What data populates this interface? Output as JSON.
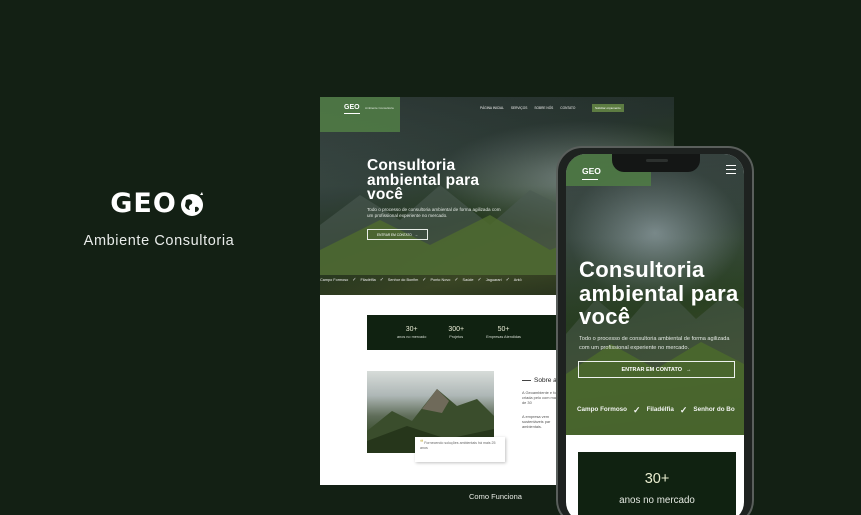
{
  "brand": {
    "logo_text": "GEO",
    "subtitle": "Ambiente Consultoria"
  },
  "desktop": {
    "logo_text": "GEO",
    "logo_tag": "Ambiente Consultoria",
    "nav": [
      "PÁGINA INICIAL",
      "SERVIÇOS",
      "SOBRE NÓS",
      "CONTATO"
    ],
    "nav_cta": "Solicitar orçamento",
    "hero_title": "Consultoria ambiental para você",
    "hero_desc": "Todo o processo de consultoria ambiental de forma agilizada com um profissional experiente no mercado.",
    "hero_button": "ENTRAR EM CONTATO",
    "ticker": [
      "Campo Formoso",
      "Filadélfia",
      "Senhor do Bonfim",
      "Ponto Novo",
      "Saúde",
      "Jaguarari",
      "Antô"
    ],
    "stats": [
      {
        "number": "30+",
        "label": "anos no mercado"
      },
      {
        "number": "300+",
        "label": "Projetos"
      },
      {
        "number": "50+",
        "label": "Empresas Atendidas"
      }
    ],
    "quote": "Fornecendo soluções ambientais há mais 25 anos",
    "about_title": "Sobre a",
    "about_p1": "A Geoambiente e foi criada pelo com mais de 30",
    "about_p2": "A empresa vem sustentáveis par ambientais.",
    "section_label": "Como Funciona"
  },
  "mobile": {
    "logo_text": "GEO",
    "hero_title": "Consultoria ambiental para você",
    "hero_desc": "Todo o processo de consultoria ambiental de forma agilizada com um profissional experiente no mercado.",
    "hero_button": "ENTRAR EM CONTATO",
    "ticker": [
      "Campo Formoso",
      "Filadélfia",
      "Senhor do Bo"
    ],
    "stat": {
      "number": "30+",
      "label": "anos no mercado"
    }
  },
  "colors": {
    "background": "#132014",
    "accent": "#4f7a45",
    "dark_panel": "#102211"
  }
}
